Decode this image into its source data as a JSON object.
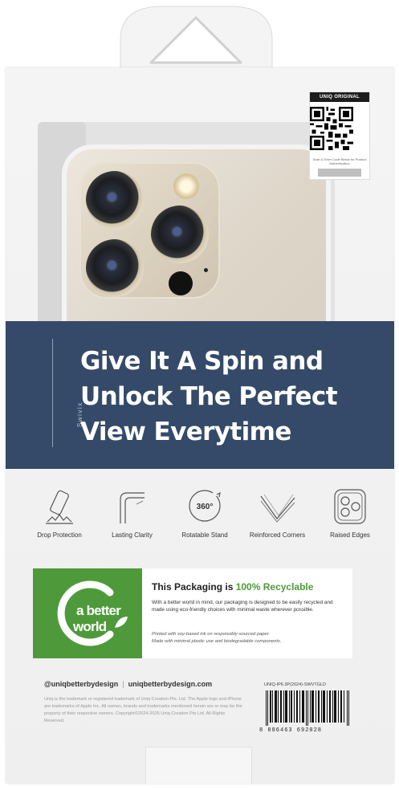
{
  "qr_sticker": {
    "heading": "UNIQ ORIGINAL",
    "note": "Scan & Enter Code Below for Product Authentication"
  },
  "band": {
    "side_label": "Swivix",
    "headline_line1": "Give It A Spin and",
    "headline_line2": "Unlock The Perfect",
    "headline_line3": "View Everytime"
  },
  "features": [
    {
      "label": "Drop Protection",
      "icon": "drop-phone-icon"
    },
    {
      "label": "Lasting Clarity",
      "icon": "clear-corner-icon"
    },
    {
      "label": "Rotatable Stand",
      "icon": "rotate-360-icon",
      "badge": "360°"
    },
    {
      "label": "Reinforced Corners",
      "icon": "corner-lines-icon"
    },
    {
      "label": "Raised Edges",
      "icon": "camera-module-icon"
    }
  ],
  "recycle": {
    "logo_line1": "a better",
    "logo_line2": "world",
    "title_prefix": "This Packaging is ",
    "title_highlight": "100% Recyclable",
    "body": "With a better world in mind, our packaging is designed to be easily recycled and made using eco-friendly choices with minimal waste wherever possible.",
    "note_line1": "Printed with soy-based ink on responsibly-sourced paper.",
    "note_line2": "Made with minimal plastic use and biodegradable components."
  },
  "info": {
    "social": "@uniqbetterbydesign",
    "website": "uniqbetterbydesign.com",
    "separator": "|",
    "legal": "Uniq is the trademark or registered trademark of Uniq Creation Pte. Ltd. The Apple logo and iPhone are trademarks of Apple Inc. All names, brands and trademarks mentioned herein are or may be the property of their respective owners. Copyright©2024-2025 Uniq Creation Pte Ltd. All Rights Reserved.",
    "sku": "UNIQ-IP6.3P(2024)-SWVTGLD",
    "barcode_number": "8   886463   692028"
  },
  "colors": {
    "band": "#344a68",
    "green": "#4e9a3a"
  }
}
